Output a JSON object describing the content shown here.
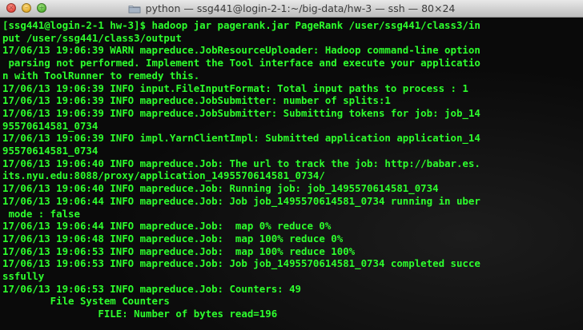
{
  "window": {
    "title": "python — ssg441@login-2-1:~/big-data/hw-3 — ssh — 80×24"
  },
  "terminal": {
    "lines": [
      "[ssg441@login-2-1 hw-3]$ hadoop jar pagerank.jar PageRank /user/ssg441/class3/in",
      "put /user/ssg441/class3/output",
      "17/06/13 19:06:39 WARN mapreduce.JobResourceUploader: Hadoop command-line option",
      " parsing not performed. Implement the Tool interface and execute your applicatio",
      "n with ToolRunner to remedy this.",
      "17/06/13 19:06:39 INFO input.FileInputFormat: Total input paths to process : 1",
      "17/06/13 19:06:39 INFO mapreduce.JobSubmitter: number of splits:1",
      "17/06/13 19:06:39 INFO mapreduce.JobSubmitter: Submitting tokens for job: job_14",
      "95570614581_0734",
      "17/06/13 19:06:39 INFO impl.YarnClientImpl: Submitted application application_14",
      "95570614581_0734",
      "17/06/13 19:06:40 INFO mapreduce.Job: The url to track the job: http://babar.es.",
      "its.nyu.edu:8088/proxy/application_1495570614581_0734/",
      "17/06/13 19:06:40 INFO mapreduce.Job: Running job: job_1495570614581_0734",
      "17/06/13 19:06:44 INFO mapreduce.Job: Job job_1495570614581_0734 running in uber",
      " mode : false",
      "17/06/13 19:06:44 INFO mapreduce.Job:  map 0% reduce 0%",
      "17/06/13 19:06:48 INFO mapreduce.Job:  map 100% reduce 0%",
      "17/06/13 19:06:53 INFO mapreduce.Job:  map 100% reduce 100%",
      "17/06/13 19:06:53 INFO mapreduce.Job: Job job_1495570614581_0734 completed succe",
      "ssfully",
      "17/06/13 19:06:53 INFO mapreduce.Job: Counters: 49",
      "        File System Counters",
      "                FILE: Number of bytes read=196"
    ]
  },
  "colors": {
    "text": "#2dff2d",
    "background": "#0a0a0a"
  },
  "icons": {
    "close": "close-icon",
    "minimize": "minimize-icon",
    "maximize": "maximize-icon",
    "title": "folder-icon"
  }
}
